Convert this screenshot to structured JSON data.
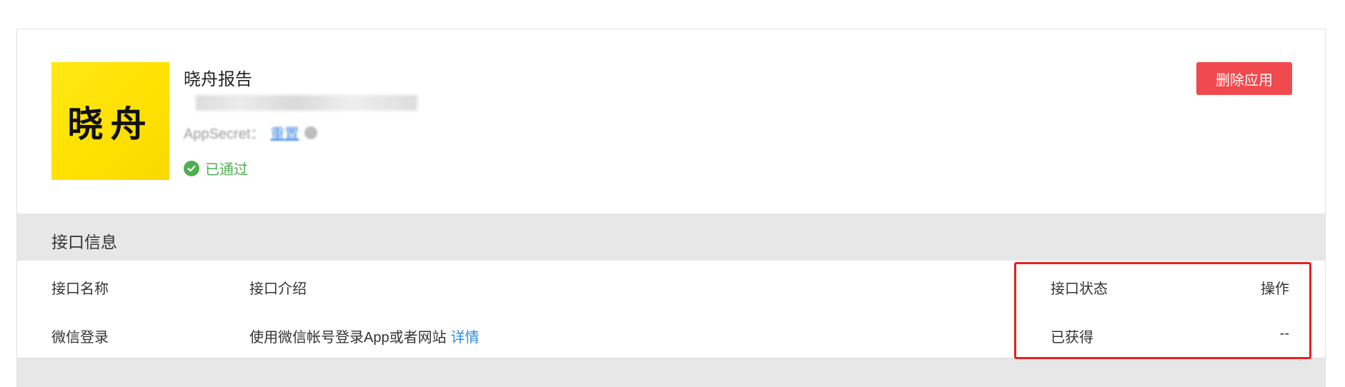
{
  "app": {
    "logo_text": "晓舟",
    "name": "晓舟报告",
    "secret_label": "AppSecret：",
    "secret_action": "重置",
    "status": "已通过"
  },
  "actions": {
    "delete_label": "删除应用"
  },
  "colors": {
    "accent_red": "#f04a4f",
    "success_green": "#4caf50",
    "link_blue": "#2f8ae6",
    "logo_yellow": "#ffe816",
    "highlight_red": "#e82020"
  },
  "interface_section": {
    "title": "接口信息",
    "columns": {
      "name": "接口名称",
      "intro": "接口介绍",
      "status": "接口状态",
      "operation": "操作"
    },
    "rows": [
      {
        "name": "微信登录",
        "intro": "使用微信帐号登录App或者网站",
        "detail_link": "详情",
        "status": "已获得",
        "operation": "--"
      }
    ]
  }
}
